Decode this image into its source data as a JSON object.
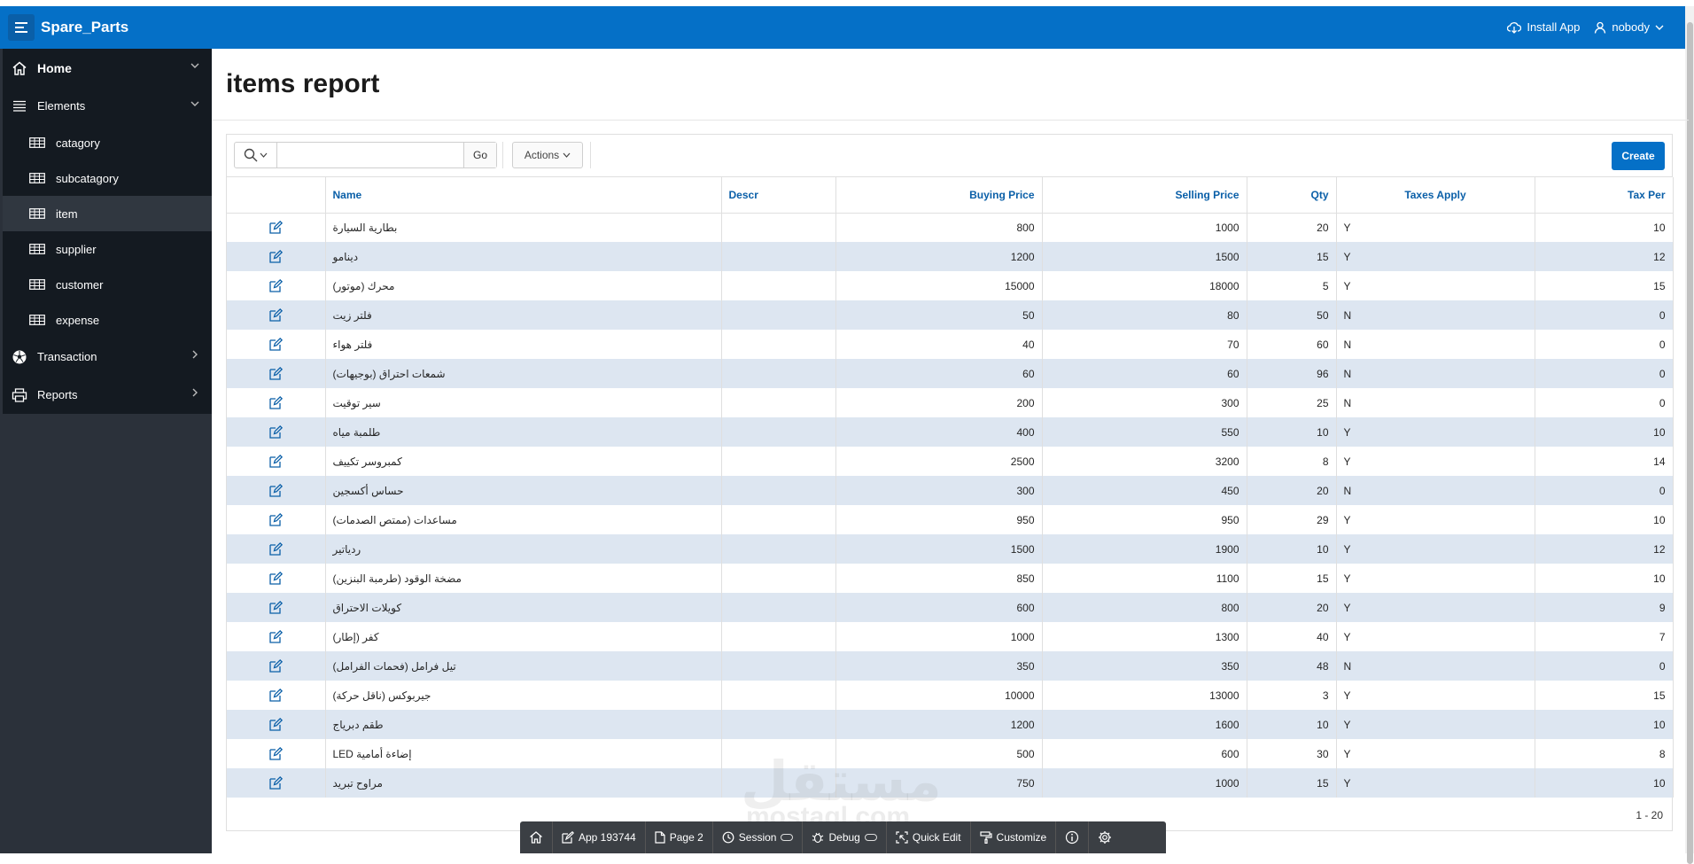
{
  "app": {
    "title": "Spare_Parts",
    "install_label": "Install App",
    "user_label": "nobody"
  },
  "sidebar": {
    "items": [
      {
        "label": "Home",
        "icon": "home-icon",
        "level": "top",
        "chevron": "down"
      },
      {
        "label": "Elements",
        "icon": "list-icon",
        "level": "top",
        "chevron": "down"
      },
      {
        "label": "catagory",
        "icon": "table-icon",
        "level": "sub"
      },
      {
        "label": "subcatagory",
        "icon": "table-icon",
        "level": "sub"
      },
      {
        "label": "item",
        "icon": "table-icon",
        "level": "sub",
        "active": true
      },
      {
        "label": "supplier",
        "icon": "table-icon",
        "level": "sub"
      },
      {
        "label": "customer",
        "icon": "table-icon",
        "level": "sub"
      },
      {
        "label": "expense",
        "icon": "table-icon",
        "level": "sub"
      },
      {
        "label": "Transaction",
        "icon": "soccer-ball-icon",
        "level": "top",
        "chevron": "right"
      },
      {
        "label": "Reports",
        "icon": "printer-icon",
        "level": "top",
        "chevron": "right"
      }
    ]
  },
  "page": {
    "title": "items report"
  },
  "toolbar": {
    "search_value": "",
    "go_label": "Go",
    "actions_label": "Actions",
    "create_label": "Create"
  },
  "table": {
    "columns": [
      "Name",
      "Descr",
      "Buying Price",
      "Selling Price",
      "Qty",
      "Taxes Apply",
      "Tax Per"
    ],
    "rows": [
      [
        "بطارية السيارة",
        "",
        "800",
        "1000",
        "20",
        "Y",
        "10"
      ],
      [
        "دينامو",
        "",
        "1200",
        "1500",
        "15",
        "Y",
        "12"
      ],
      [
        "محرك (موتور)",
        "",
        "15000",
        "18000",
        "5",
        "Y",
        "15"
      ],
      [
        "فلتر زيت",
        "",
        "50",
        "80",
        "50",
        "N",
        "0"
      ],
      [
        "فلتر هواء",
        "",
        "40",
        "70",
        "60",
        "N",
        "0"
      ],
      [
        "شمعات احتراق (بوجيهات)",
        "",
        "60",
        "60",
        "96",
        "N",
        "0"
      ],
      [
        "سير توقيت",
        "",
        "200",
        "300",
        "25",
        "N",
        "0"
      ],
      [
        "طلمبة مياه",
        "",
        "400",
        "550",
        "10",
        "Y",
        "10"
      ],
      [
        "كمبروسر تكييف",
        "",
        "2500",
        "3200",
        "8",
        "Y",
        "14"
      ],
      [
        "حساس أكسجين",
        "",
        "300",
        "450",
        "20",
        "N",
        "0"
      ],
      [
        "مساعدات (ممتص الصدمات)",
        "",
        "950",
        "950",
        "29",
        "Y",
        "10"
      ],
      [
        "ردياتير",
        "",
        "1500",
        "1900",
        "10",
        "Y",
        "12"
      ],
      [
        "مضخة الوقود (طرمبة البنزين)",
        "",
        "850",
        "1100",
        "15",
        "Y",
        "10"
      ],
      [
        "كويلات الاحتراق",
        "",
        "600",
        "800",
        "20",
        "Y",
        "9"
      ],
      [
        "كفر (إطار)",
        "",
        "1000",
        "1300",
        "40",
        "Y",
        "7"
      ],
      [
        "تيل فرامل (فحمات الفرامل)",
        "",
        "350",
        "350",
        "48",
        "N",
        "0"
      ],
      [
        "جيربوكس (ناقل حركة)",
        "",
        "10000",
        "13000",
        "3",
        "Y",
        "15"
      ],
      [
        "طقم دبرياج",
        "",
        "1200",
        "1600",
        "10",
        "Y",
        "10"
      ],
      [
        "إضاءة أمامية LED",
        "",
        "500",
        "600",
        "30",
        "Y",
        "8"
      ],
      [
        "مراوح تبريد",
        "",
        "750",
        "1000",
        "15",
        "Y",
        "10"
      ]
    ],
    "pagination": "1 - 20"
  },
  "watermark": {
    "arabic": "مستقل",
    "latin": "mostaql.com"
  },
  "devbar": {
    "items": [
      {
        "label": "",
        "icon": "home-icon"
      },
      {
        "label": "App 193744",
        "icon": "edit-icon"
      },
      {
        "label": "Page 2",
        "icon": "page-icon"
      },
      {
        "label": "Session",
        "icon": "session-icon"
      },
      {
        "label": "Debug",
        "icon": "bug-icon"
      },
      {
        "label": "Quick Edit",
        "icon": "quick-edit-icon"
      },
      {
        "label": "Customize",
        "icon": "paint-roller-icon"
      },
      {
        "label": "",
        "icon": "info-icon"
      },
      {
        "label": "",
        "icon": "gear-icon"
      }
    ]
  },
  "colors": {
    "header": "#0570c7",
    "sidebar": "#141a21",
    "row_alt": "#dde6f1",
    "link": "#0a5fa8"
  }
}
